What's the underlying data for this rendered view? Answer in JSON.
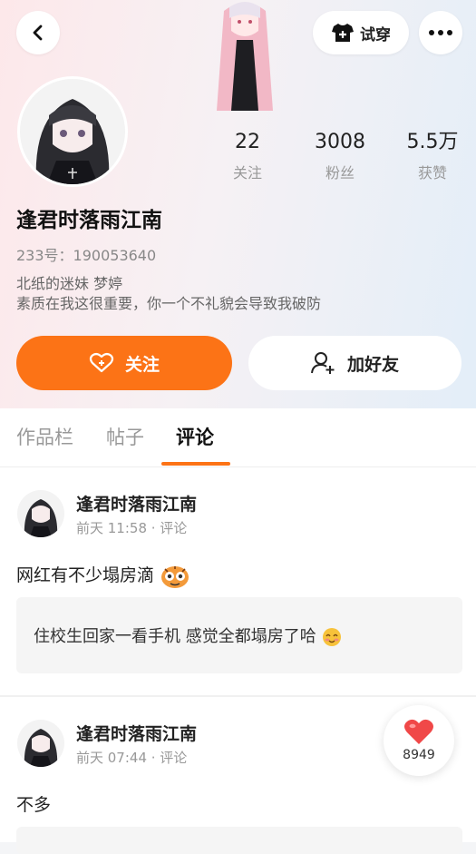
{
  "header": {
    "tryon_label": "试穿"
  },
  "profile": {
    "username": "逢君时落雨江南",
    "uid": "233号：190053640",
    "bio_line1": "北纸的迷妹 梦婷",
    "bio_line2": "素质在我这很重要，你一个不礼貌会导致我破防"
  },
  "stats": [
    {
      "value": "22",
      "label": "关注"
    },
    {
      "value": "3008",
      "label": "粉丝"
    },
    {
      "value": "5.5万",
      "label": "获赞"
    }
  ],
  "actions": {
    "follow_label": "关注",
    "add_friend_label": "加好友"
  },
  "tabs": [
    {
      "label": "作品栏"
    },
    {
      "label": "帖子"
    },
    {
      "label": "评论"
    }
  ],
  "posts": [
    {
      "author": "逢君时落雨江南",
      "meta": "前天 11:58 · 评论",
      "text": "网红有不少塌房滴",
      "quote": "住校生回家一看手机 感觉全都塌房了哈"
    },
    {
      "author": "逢君时落雨江南",
      "meta": "前天 07:44 · 评论",
      "text": "不多"
    }
  ],
  "like": {
    "count": "8949"
  },
  "colors": {
    "accent": "#fc7316",
    "like_red": "#f04848"
  },
  "icons": {
    "back": "chevron-left-icon",
    "tryon": "tshirt-icon",
    "more": "more-dots-icon",
    "follow": "heart-plus-icon",
    "add_friend": "person-plus-icon",
    "like": "heart-icon"
  }
}
